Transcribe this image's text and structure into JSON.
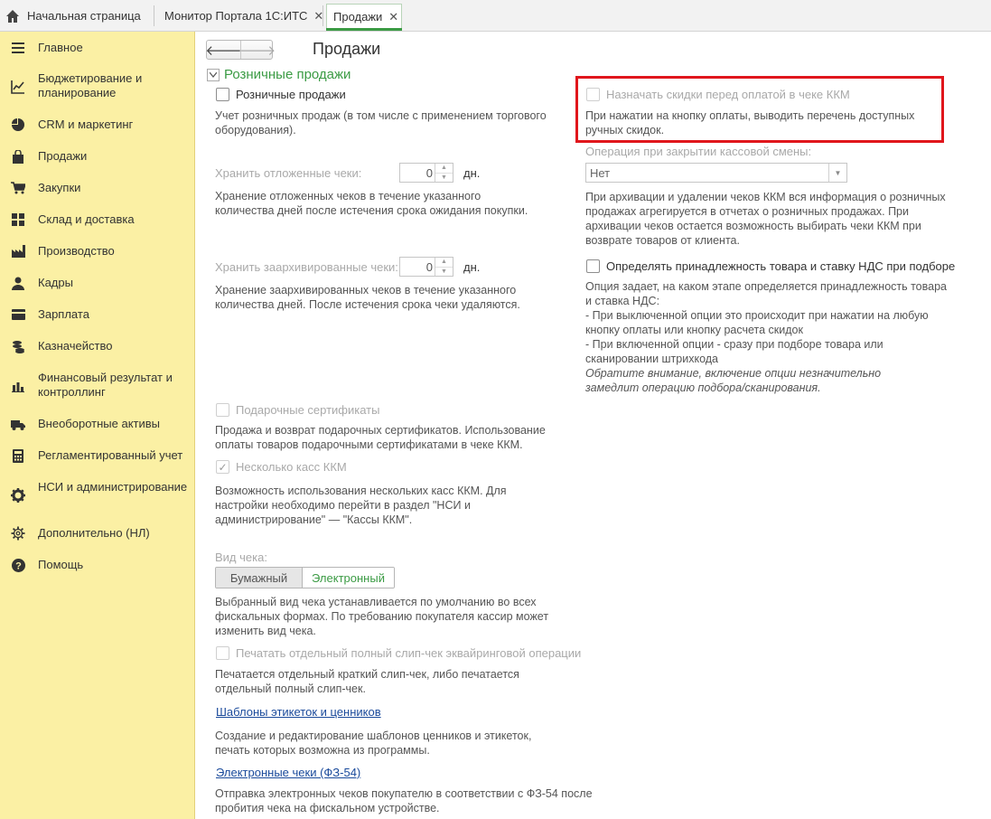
{
  "tabs": [
    {
      "label": "Начальная страница",
      "icon": "home-icon"
    },
    {
      "label": "Монитор Портала 1С:ИТС",
      "close": "✕"
    },
    {
      "label": "Продажи",
      "close": "✕",
      "active": true
    }
  ],
  "sidebar": {
    "items": [
      {
        "label": "Главное",
        "icon": "menu-lines-icon"
      },
      {
        "label": "Бюджетирование и планирование",
        "icon": "budget-chart-icon"
      },
      {
        "label": "CRM и маркетинг",
        "icon": "pie-chart-icon"
      },
      {
        "label": "Продажи",
        "icon": "shopping-bag-icon"
      },
      {
        "label": "Закупки",
        "icon": "cart-icon"
      },
      {
        "label": "Склад и доставка",
        "icon": "warehouse-grid-icon"
      },
      {
        "label": "Производство",
        "icon": "factory-icon"
      },
      {
        "label": "Кадры",
        "icon": "person-icon"
      },
      {
        "label": "Зарплата",
        "icon": "wallet-icon"
      },
      {
        "label": "Казначейство",
        "icon": "coins-icon"
      },
      {
        "label": "Финансовый результат и контроллинг",
        "icon": "bar-chart-icon"
      },
      {
        "label": "Внеоборотные активы",
        "icon": "truck-icon"
      },
      {
        "label": "Регламентированный учет",
        "icon": "calculator-icon"
      },
      {
        "label": "НСИ и администрирование",
        "icon": "gear-icon"
      },
      {
        "label": "Дополнительно (НЛ)",
        "icon": "settings-outline-icon"
      },
      {
        "label": "Помощь",
        "icon": "help-icon"
      }
    ]
  },
  "page": {
    "title": "Продажи",
    "nav_back": "🡐",
    "nav_forward": "🡒"
  },
  "retail": {
    "group_title": "Розничные продажи",
    "retail_cb_label": "Розничные продажи",
    "retail_desc": "Учет розничных продаж (в том числе с применением торгового оборудования).",
    "deferred_label": "Хранить отложенные чеки:",
    "deferred_value": "0",
    "deferred_unit": "дн.",
    "deferred_desc": "Хранение отложенных чеков в течение указанного количества дней после истечения срока ожидания покупки.",
    "archived_label": "Хранить заархивированные чеки:",
    "archived_value": "0",
    "archived_unit": "дн.",
    "archived_desc": "Хранение заархивированных чеков в течение указанного количества дней. После истечения срока чеки удаляются.",
    "gift_cb_label": "Подарочные сертификаты",
    "gift_desc": "Продажа и возврат подарочных сертификатов. Использование оплаты товаров подарочными сертификатами в чеке ККМ.",
    "multi_kkm_label": "Несколько касс ККМ",
    "multi_kkm_check": "✓",
    "multi_kkm_desc": "Возможность использования нескольких касс ККМ. Для настройки необходимо перейти в раздел \"НСИ и администрирование\" — \"Кассы ККМ\".",
    "receipt_type_label": "Вид чека:",
    "receipt_paper": "Бумажный",
    "receipt_electronic": "Электронный",
    "receipt_type_desc": "Выбранный вид чека устанавливается по умолчанию во всех фискальных формах. По требованию покупателя кассир может изменить вид чека.",
    "slip_label": "Печатать отдельный полный слип-чек эквайринговой операции",
    "slip_desc": "Печатается отдельный краткий слип-чек, либо печатается отдельный полный слип-чек.",
    "templates_link": "Шаблоны этикеток и ценников",
    "templates_desc": "Создание и редактирование шаблонов ценников и этикеток, печать которых возможна из программы.",
    "ereceipts_link": "Электронные чеки (ФЗ-54)",
    "ereceipts_desc": "Отправка электронных чеков покупателю в соответствии с ФЗ-54 после пробития чека на фискальном устройстве."
  },
  "right": {
    "discount_label": "Назначать скидки перед оплатой в чеке ККМ",
    "discount_desc": "При нажатии на кнопку оплаты, выводить перечень доступных ручных скидок.",
    "closing_label": "Операция при закрытии кассовой смены:",
    "closing_value": "Нет",
    "closing_desc": "При архивации и удалении чеков ККМ вся информация о розничных продажах агрегируется в отчетах о розничных продажах. При архивации чеков остается возможность выбирать чеки ККМ при возврате товаров от клиента.",
    "vat_label": "Определять принадлежность товара и ставку НДС при подборе",
    "vat_desc_1": "Опция задает, на каком этапе определяется принадлежность товара и ставка НДС:",
    "vat_desc_2": "- При выключенной опции это происходит при нажатии на любую кнопку оплаты или кнопку расчета скидок",
    "vat_desc_3": "- При включенной опции - сразу при подборе товара или сканировании штрихкода",
    "vat_note": "Обратите внимание, включение опции незначительно замедлит операцию подбора/сканирования."
  },
  "colors": {
    "sidebar_bg": "#fbf0a4",
    "accent_green": "#3b9b44",
    "highlight_red": "#e0161c",
    "link_blue": "#1a4a9b"
  }
}
